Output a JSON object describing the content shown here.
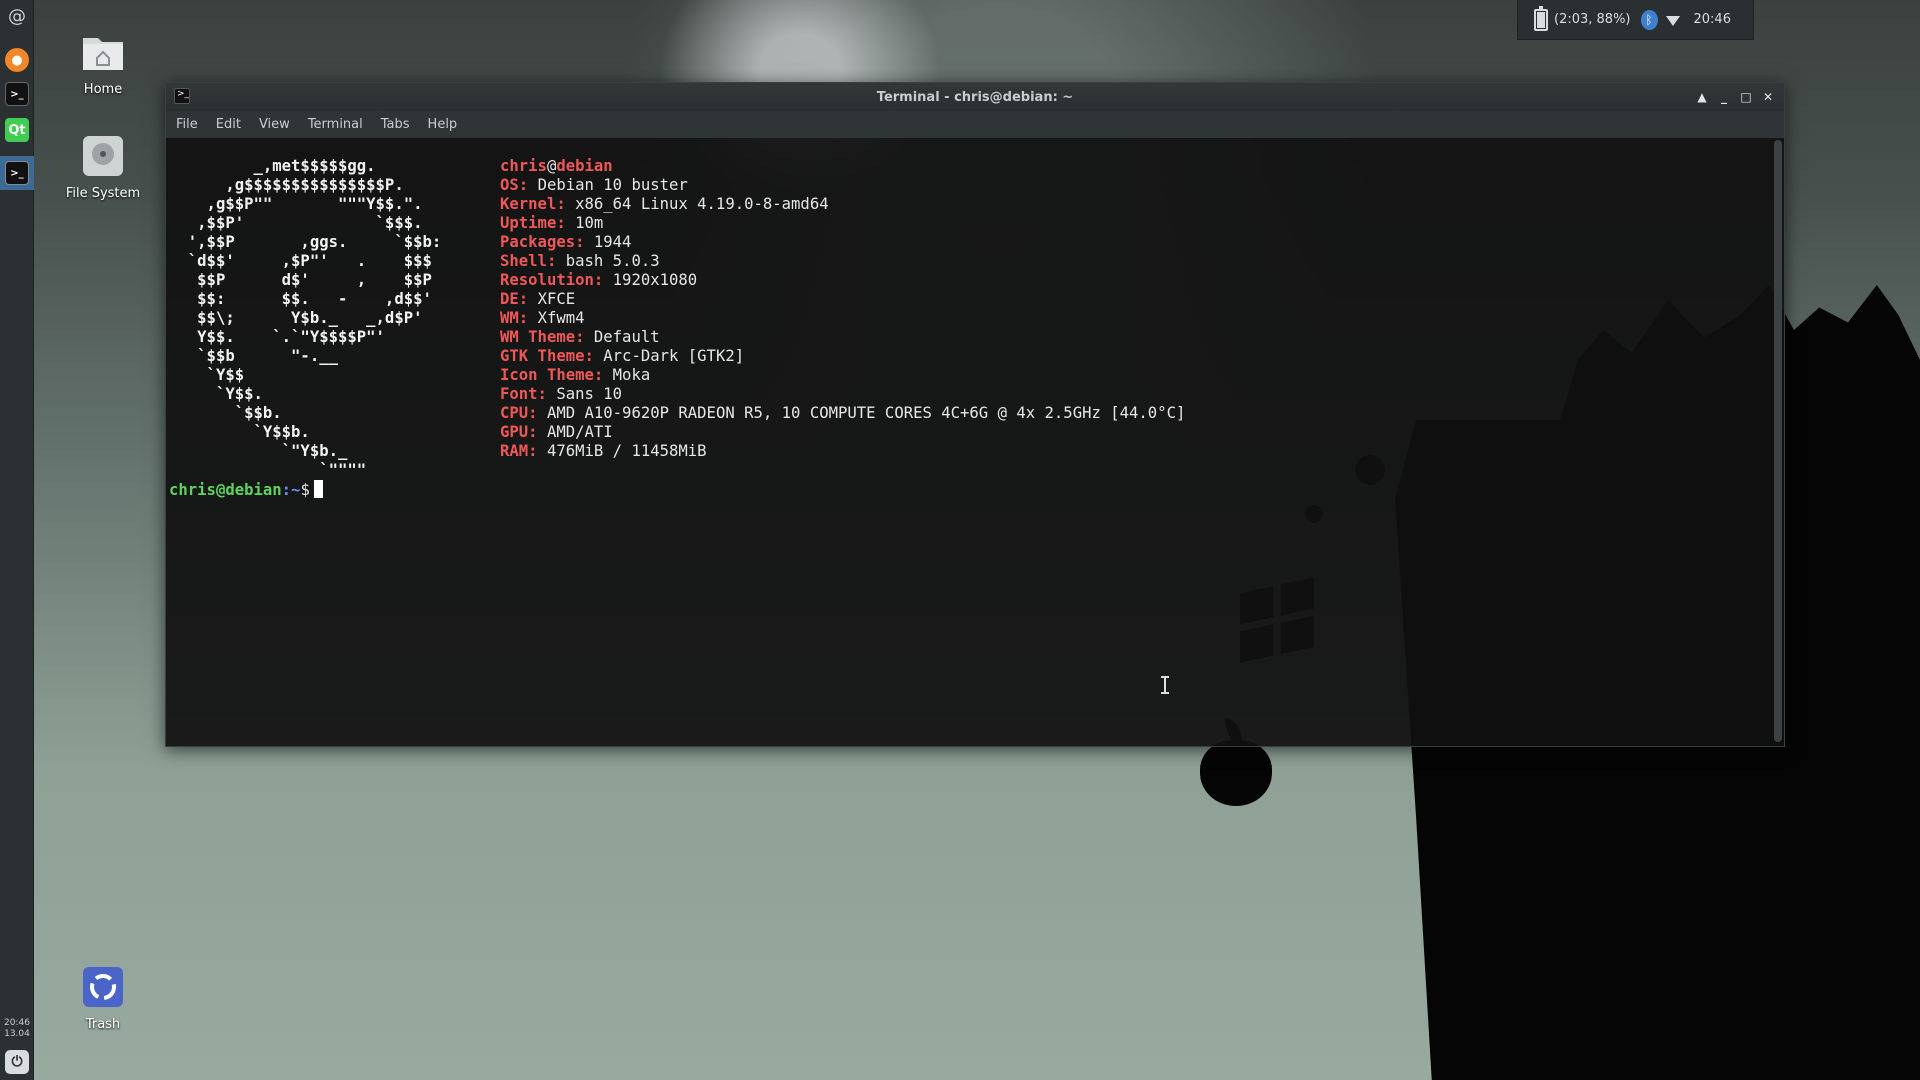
{
  "desktop": {
    "icons": [
      {
        "label": "Home",
        "icon": "home-folder-icon"
      },
      {
        "label": "File System",
        "icon": "hard-drive-icon"
      },
      {
        "label": "Trash",
        "icon": "trash-icon"
      }
    ]
  },
  "left_panel": {
    "launchers": [
      "debian-menu-icon",
      "firefox-icon",
      "terminal-icon",
      "qt-creator-icon",
      "terminal-window-icon"
    ],
    "qt_label": "Qt",
    "clock_time": "20:46",
    "clock_date": "13.04",
    "power_icon": "power-icon"
  },
  "tray": {
    "battery_text": "(2:03, 88%)",
    "time": "20:46",
    "colors": {
      "bluetooth": "#3f7fd0"
    }
  },
  "terminal": {
    "title": "Terminal - chris@debian: ~",
    "menu": [
      "File",
      "Edit",
      "View",
      "Terminal",
      "Tabs",
      "Help"
    ],
    "user": "chris",
    "at": "@",
    "host": "debian",
    "info": [
      {
        "key": "OS:",
        "value": "Debian 10 buster"
      },
      {
        "key": "Kernel:",
        "value": "x86_64 Linux 4.19.0-8-amd64"
      },
      {
        "key": "Uptime:",
        "value": "10m"
      },
      {
        "key": "Packages:",
        "value": "1944"
      },
      {
        "key": "Shell:",
        "value": "bash 5.0.3"
      },
      {
        "key": "Resolution:",
        "value": "1920x1080"
      },
      {
        "key": "DE:",
        "value": "XFCE"
      },
      {
        "key": "WM:",
        "value": "Xfwm4"
      },
      {
        "key": "WM Theme:",
        "value": "Default"
      },
      {
        "key": "GTK Theme:",
        "value": "Arc-Dark [GTK2]"
      },
      {
        "key": "Icon Theme:",
        "value": "Moka"
      },
      {
        "key": "Font:",
        "value": "Sans 10"
      },
      {
        "key": "CPU:",
        "value": "AMD A10-9620P RADEON R5, 10 COMPUTE CORES 4C+6G @ 4x 2.5GHz [44.0°C]"
      },
      {
        "key": "GPU:",
        "value": "AMD/ATI"
      },
      {
        "key": "RAM:",
        "value": "476MiB / 11458MiB"
      }
    ],
    "logo_lines": [
      "         _,met$$$$$gg.",
      "      ,g$$$$$$$$$$$$$$$P.",
      "    ,g$$P\"\"       \"\"\"Y$$.\".",
      "   ,$$P'              `$$$.",
      "  ',$$P       ,ggs.     `$$b:",
      "  `d$$'     ,$P\"'   .    $$$",
      "   $$P      d$'     ,    $$P",
      "   $$:      $$.   -    ,d$$'",
      "   $$\\;      Y$b._   _,d$P'",
      "   Y$$.    `.`\"Y$$$$P\"'",
      "   `$$b      \"-.__",
      "    `Y$$",
      "     `Y$$.",
      "       `$$b.",
      "         `Y$$b.",
      "            `\"Y$b._",
      "                `\"\"\"\""
    ],
    "prompt_user": "chris@debian",
    "prompt_path": ":~",
    "prompt_sign": "$",
    "colors": {
      "key": "#ef5858",
      "prompt_user": "#5ed35e",
      "prompt_path": "#6a8ef0"
    }
  }
}
